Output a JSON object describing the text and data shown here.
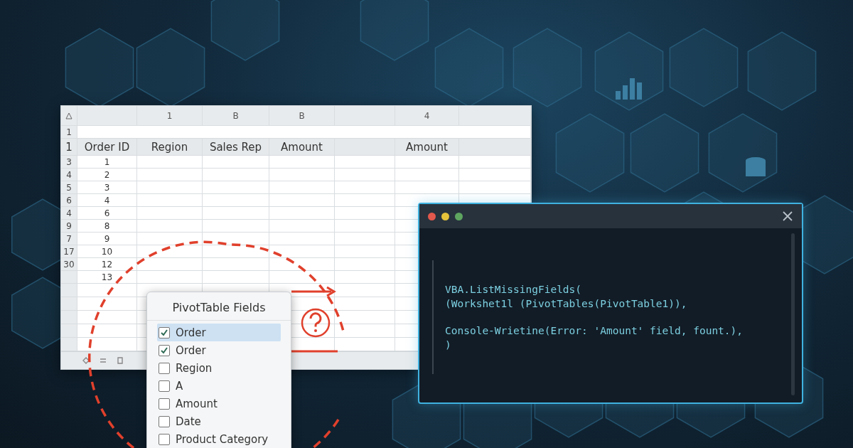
{
  "spreadsheet": {
    "columns": [
      {
        "heading": "Order ID"
      },
      {
        "letter": "1",
        "heading": "Region"
      },
      {
        "letter": "B",
        "heading": "Sales Rep"
      },
      {
        "letter": "B",
        "heading": "Amount"
      },
      {},
      {
        "letter": "4",
        "heading": "Amount"
      },
      {}
    ],
    "blank_row": {
      "row_number": "1"
    },
    "header_row": {
      "row_number": "1"
    },
    "rows": [
      {
        "row_number": "3",
        "order_id": "1"
      },
      {
        "row_number": "4",
        "order_id": "2"
      },
      {
        "row_number": "5",
        "order_id": "3"
      },
      {
        "row_number": "6",
        "order_id": "4"
      },
      {
        "row_number": "4",
        "order_id": "6"
      },
      {
        "row_number": "9",
        "order_id": "8"
      },
      {
        "row_number": "7",
        "order_id": "9"
      },
      {
        "row_number": "17",
        "order_id": "10"
      },
      {
        "row_number": "30",
        "order_id": "12"
      },
      {
        "order_id": "13"
      }
    ]
  },
  "pivot_fields": {
    "title": "PivotTable Fields",
    "items": [
      {
        "label": "Order",
        "checked": true,
        "selected": true
      },
      {
        "label": "Order",
        "checked": true,
        "selected": false
      },
      {
        "label": "Region",
        "checked": false,
        "selected": false
      },
      {
        "label": "A",
        "checked": false,
        "selected": false
      },
      {
        "label": "Amount",
        "checked": false,
        "selected": false
      },
      {
        "label": "Date",
        "checked": false,
        "selected": false
      },
      {
        "label": "Product Category",
        "checked": false,
        "selected": false
      }
    ]
  },
  "code_window": {
    "blocks": [
      [
        "VBA.ListMissingFields(",
        "(Workshet1l (PivotTables(PivotTable1)),"
      ],
      [
        "Console-Wrietine(Error: 'Amount' field, fount.),",
        ")"
      ]
    ]
  }
}
